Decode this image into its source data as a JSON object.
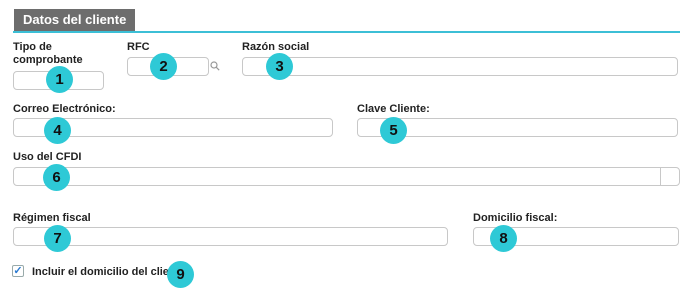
{
  "section": {
    "title": "Datos del cliente"
  },
  "fields": {
    "tipo_comprobante": {
      "label_line1": "Tipo de",
      "label_line2": "comprobante",
      "value": "",
      "badge": "1"
    },
    "rfc": {
      "label": "RFC",
      "value": "",
      "badge": "2",
      "icon": "search-icon"
    },
    "razon_social": {
      "label": "Razón social",
      "value": "",
      "badge": "3"
    },
    "correo": {
      "label": "Correo Electrónico:",
      "value": "",
      "badge": "4"
    },
    "clave_cliente": {
      "label": "Clave Cliente:",
      "value": "",
      "badge": "5"
    },
    "uso_cfdi": {
      "label": "Uso del CFDI",
      "value": "",
      "badge": "6"
    },
    "regimen_fiscal": {
      "label": "Régimen fiscal",
      "value": "",
      "badge": "7"
    },
    "domicilio_fiscal": {
      "label": "Domicilio fiscal:",
      "value": "",
      "badge": "8"
    }
  },
  "incluir_domicilio": {
    "label": "Incluir el domicilio del cliente",
    "checked": true,
    "badge": "9"
  },
  "colors": {
    "header_bg": "#6d6d6d",
    "accent_rule": "#3cbfd6",
    "badge": "#2ec9d6",
    "check": "#2a7ad1"
  }
}
